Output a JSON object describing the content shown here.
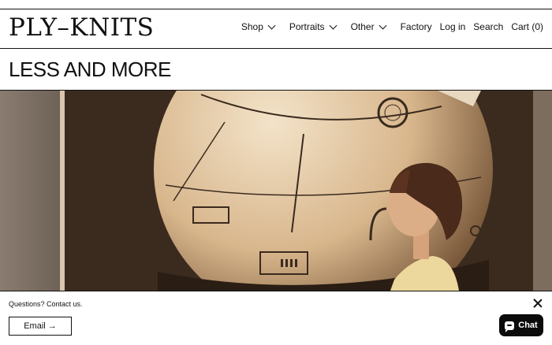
{
  "brand": {
    "logo_text": "PLY–KNITS"
  },
  "nav": {
    "items": [
      {
        "label": "Shop",
        "dropdown": true
      },
      {
        "label": "Portraits",
        "dropdown": true
      },
      {
        "label": "Other",
        "dropdown": true
      },
      {
        "label": "Factory",
        "dropdown": false
      },
      {
        "label": "Log in",
        "dropdown": false
      },
      {
        "label": "Search",
        "dropdown": false
      },
      {
        "label": "Cart (0)",
        "dropdown": false
      }
    ]
  },
  "page": {
    "title": "LESS AND MORE"
  },
  "hero": {
    "image_description_icon": "photo-woman-beside-sculpture"
  },
  "contact_bar": {
    "question_text": "Questions? Contact us.",
    "email_label": "Email →"
  },
  "chat": {
    "label": "Chat"
  },
  "colors": {
    "text": "#111111",
    "chat_bg": "#0b0b0b",
    "hero_tone": "#c9a67a"
  }
}
